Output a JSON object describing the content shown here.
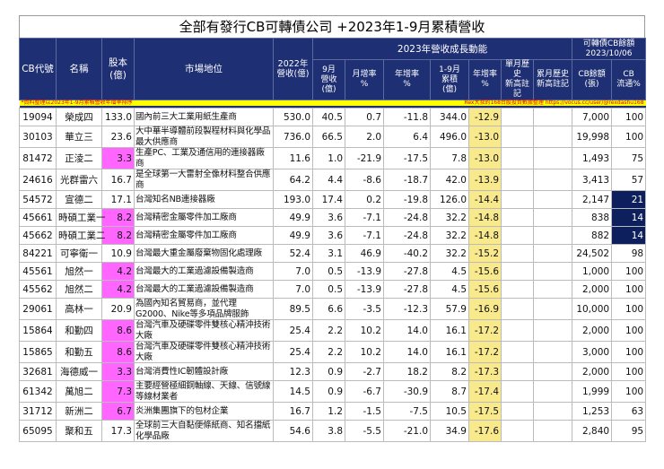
{
  "title": "全部有發行CB可轉債公司 +2023年1-9月累積營收",
  "headers": {
    "code": "CB代號",
    "name": "名稱",
    "capital": "股本\n(億)",
    "market": "市場地位",
    "rev2022": "2022年\n營收(億)",
    "group_growth": "2023年營收成長動能",
    "group_cb": "可轉債CB餘額\n2023/10/06",
    "sep_rev": "9月\n營收\n(億)",
    "mom": "月增率\n%",
    "yoy": "年增率\n%",
    "cum_rev": "1-9月\n累積\n(億)",
    "cum_yoy": "年增率\n%",
    "month_high": "單月歷史\n新高註記",
    "cum_high": "累月歷史\n新高註記",
    "cb_balance": "CB餘額\n(張)",
    "cb_float": "CB\n流通%"
  },
  "banner": {
    "left": "*資料整理以2023年1-9月累積營收年增率排序",
    "right": "Rex大叔的168台股投資數據整理 https://vocus.cc/user/@rexdashu168"
  },
  "colors": {
    "header": "#1f2f73",
    "magenta": "#ff66ff",
    "yellow_col": "#f8e98c",
    "navy": "#0e1f5e",
    "banner": "#ffff00"
  },
  "rows": [
    {
      "code": "19094",
      "name": "榮成四",
      "capital": "133.0",
      "market": "國內前三大工業用紙生產商",
      "rev2022": "530.0",
      "sep": "40.5",
      "mom": "0.7",
      "yoy": "-11.8",
      "cum": "344.0",
      "cum_yoy": "-12.9",
      "mh": "",
      "ch": "",
      "bal": "7,000",
      "flt": "100",
      "cap_hl": false,
      "flt_hl": false
    },
    {
      "code": "30103",
      "name": "華立三",
      "capital": "23.6",
      "market": "大中華半導體前段製程材料與化學品最大供應商",
      "rev2022": "736.0",
      "sep": "66.5",
      "mom": "2.0",
      "yoy": "6.4",
      "cum": "496.0",
      "cum_yoy": "-13.0",
      "mh": "",
      "ch": "",
      "bal": "19,998",
      "flt": "100",
      "cap_hl": false,
      "flt_hl": false
    },
    {
      "code": "81472",
      "name": "正淩二",
      "capital": "3.3",
      "market": "生產PC、工業及通信用的連接器廠商",
      "rev2022": "11.6",
      "sep": "1.0",
      "mom": "-21.9",
      "yoy": "-17.5",
      "cum": "7.8",
      "cum_yoy": "-13.0",
      "mh": "",
      "ch": "",
      "bal": "1,493",
      "flt": "75",
      "cap_hl": true,
      "flt_hl": false
    },
    {
      "code": "24616",
      "name": "光群雷六",
      "capital": "16.7",
      "market": "是全球第一大雷射全像材料整合供應商",
      "rev2022": "64.2",
      "sep": "4.4",
      "mom": "-8.6",
      "yoy": "-18.7",
      "cum": "42.0",
      "cum_yoy": "-13.9",
      "mh": "",
      "ch": "",
      "bal": "3,413",
      "flt": "57",
      "cap_hl": false,
      "flt_hl": false
    },
    {
      "code": "54572",
      "name": "宣德二",
      "capital": "17.1",
      "market": "台灣知名NB連接器廠",
      "rev2022": "193.0",
      "sep": "17.4",
      "mom": "0.2",
      "yoy": "-19.8",
      "cum": "126.0",
      "cum_yoy": "-14.4",
      "mh": "",
      "ch": "",
      "bal": "2,147",
      "flt": "21",
      "cap_hl": false,
      "flt_hl": true
    },
    {
      "code": "45661",
      "name": "時碩工業一",
      "capital": "8.2",
      "market": "台灣精密金屬零件加工廠商",
      "rev2022": "49.9",
      "sep": "3.6",
      "mom": "-7.1",
      "yoy": "-24.8",
      "cum": "32.2",
      "cum_yoy": "-14.8",
      "mh": "",
      "ch": "",
      "bal": "838",
      "flt": "14",
      "cap_hl": true,
      "flt_hl": true
    },
    {
      "code": "45662",
      "name": "時碩工業二",
      "capital": "8.2",
      "market": "台灣精密金屬零件加工廠商",
      "rev2022": "49.9",
      "sep": "3.6",
      "mom": "-7.1",
      "yoy": "-24.8",
      "cum": "32.2",
      "cum_yoy": "-14.8",
      "mh": "",
      "ch": "",
      "bal": "882",
      "flt": "14",
      "cap_hl": true,
      "flt_hl": true
    },
    {
      "code": "84221",
      "name": "可寧衛一",
      "capital": "10.9",
      "market": "台灣最大重金屬廢棄物固化處理廠",
      "rev2022": "52.4",
      "sep": "3.1",
      "mom": "46.9",
      "yoy": "-40.2",
      "cum": "32.2",
      "cum_yoy": "-15.2",
      "mh": "",
      "ch": "",
      "bal": "24,502",
      "flt": "98",
      "cap_hl": false,
      "flt_hl": false
    },
    {
      "code": "45561",
      "name": "旭然一",
      "capital": "4.2",
      "market": "台灣最大的工業過濾設備製造商",
      "rev2022": "7.0",
      "sep": "0.5",
      "mom": "-13.9",
      "yoy": "-27.8",
      "cum": "4.5",
      "cum_yoy": "-15.6",
      "mh": "",
      "ch": "",
      "bal": "1,000",
      "flt": "100",
      "cap_hl": true,
      "flt_hl": false
    },
    {
      "code": "45562",
      "name": "旭然二",
      "capital": "4.2",
      "market": "台灣最大的工業過濾設備製造商",
      "rev2022": "7.0",
      "sep": "0.5",
      "mom": "-13.9",
      "yoy": "-27.8",
      "cum": "4.5",
      "cum_yoy": "-15.6",
      "mh": "",
      "ch": "",
      "bal": "2,000",
      "flt": "100",
      "cap_hl": true,
      "flt_hl": false
    },
    {
      "code": "29061",
      "name": "高林一",
      "capital": "20.9",
      "market": "為國內知名貿易商，並代理G2000、Nike等多項品牌服飾",
      "rev2022": "89.5",
      "sep": "6.6",
      "mom": "-3.5",
      "yoy": "-12.3",
      "cum": "57.9",
      "cum_yoy": "-16.9",
      "mh": "",
      "ch": "",
      "bal": "10,000",
      "flt": "100",
      "cap_hl": false,
      "flt_hl": false
    },
    {
      "code": "15864",
      "name": "和勤四",
      "capital": "8.6",
      "market": "台灣汽車及硬碟零件雙核心精沖技術大廠",
      "rev2022": "25.4",
      "sep": "2.2",
      "mom": "10.2",
      "yoy": "14.0",
      "cum": "16.1",
      "cum_yoy": "-17.2",
      "mh": "",
      "ch": "",
      "bal": "2,000",
      "flt": "100",
      "cap_hl": true,
      "flt_hl": false
    },
    {
      "code": "15865",
      "name": "和勤五",
      "capital": "8.6",
      "market": "台灣汽車及硬碟零件雙核心精沖技術大廠",
      "rev2022": "25.4",
      "sep": "2.2",
      "mom": "10.2",
      "yoy": "14.0",
      "cum": "16.1",
      "cum_yoy": "-17.2",
      "mh": "",
      "ch": "",
      "bal": "3,000",
      "flt": "100",
      "cap_hl": true,
      "flt_hl": false
    },
    {
      "code": "32681",
      "name": "海德威一",
      "capital": "3.3",
      "market": "台灣消費性IC韌體設計廠",
      "rev2022": "12.3",
      "sep": "0.9",
      "mom": "-2.7",
      "yoy": "18.2",
      "cum": "8.2",
      "cum_yoy": "-17.3",
      "mh": "",
      "ch": "",
      "bal": "2,000",
      "flt": "100",
      "cap_hl": true,
      "flt_hl": false
    },
    {
      "code": "61342",
      "name": "萬旭二",
      "capital": "7.3",
      "market": "主要經營極細銅軸線、天線、信號線等線材業者",
      "rev2022": "14.5",
      "sep": "0.9",
      "mom": "-6.7",
      "yoy": "-30.9",
      "cum": "8.7",
      "cum_yoy": "-17.4",
      "mh": "",
      "ch": "",
      "bal": "1,999",
      "flt": "100",
      "cap_hl": true,
      "flt_hl": false
    },
    {
      "code": "31712",
      "name": "新洲二",
      "capital": "6.7",
      "market": "炎洲集團旗下的包材企業",
      "rev2022": "16.7",
      "sep": "1.2",
      "mom": "-1.5",
      "yoy": "-7.5",
      "cum": "10.5",
      "cum_yoy": "-17.5",
      "mh": "",
      "ch": "",
      "bal": "1,253",
      "flt": "63",
      "cap_hl": true,
      "flt_hl": false
    },
    {
      "code": "65095",
      "name": "聚和五",
      "capital": "17.3",
      "market": "全球前三大自黏便條紙商、知名擋紙化學品廠",
      "rev2022": "54.6",
      "sep": "3.8",
      "mom": "-5.5",
      "yoy": "-21.0",
      "cum": "34.9",
      "cum_yoy": "-17.6",
      "mh": "",
      "ch": "",
      "bal": "2,840",
      "flt": "95",
      "cap_hl": false,
      "flt_hl": false
    }
  ]
}
